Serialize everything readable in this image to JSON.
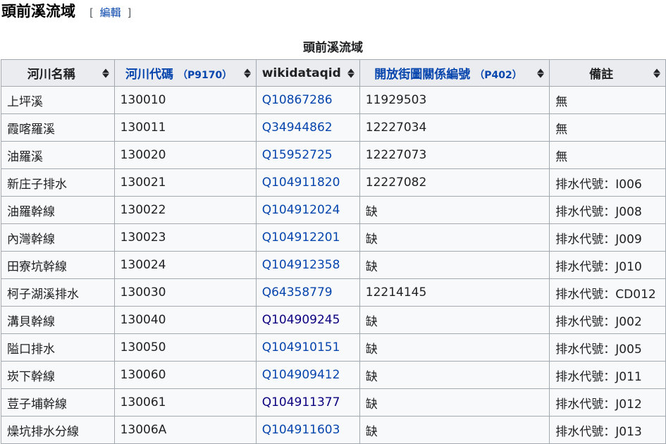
{
  "section": {
    "title": "頭前溪流域",
    "edit_open": "[",
    "edit_label": "編輯",
    "edit_close": "]"
  },
  "table": {
    "caption": "頭前溪流域",
    "headers": [
      {
        "label": "河川名稱",
        "prop": "",
        "link": false
      },
      {
        "label": "河川代碼",
        "prop": "（P9170）",
        "link": true
      },
      {
        "label": "wikidataqid",
        "prop": "",
        "link": false
      },
      {
        "label": "開放街圖關係編號",
        "prop": "（P402）",
        "link": true
      },
      {
        "label": "備註",
        "prop": "",
        "link": false
      }
    ],
    "rows": [
      {
        "name": "上坪溪",
        "code": "130010",
        "qid": "Q10867286",
        "osm": "11929503",
        "note": "無"
      },
      {
        "name": "霞喀羅溪",
        "code": "130011",
        "qid": "Q34944862",
        "osm": "12227034",
        "note": "無"
      },
      {
        "name": "油羅溪",
        "code": "130020",
        "qid": "Q15952725",
        "osm": "12227073",
        "note": "無"
      },
      {
        "name": "新庄子排水",
        "code": "130021",
        "qid": "Q104911820",
        "osm": "12227082",
        "note": "排水代號：I006"
      },
      {
        "name": "油羅幹線",
        "code": "130022",
        "qid": "Q104912024",
        "osm": "缺",
        "note": "排水代號：J008"
      },
      {
        "name": "內灣幹線",
        "code": "130023",
        "qid": "Q104912201",
        "osm": "缺",
        "note": "排水代號：J009"
      },
      {
        "name": "田寮坑幹線",
        "code": "130024",
        "qid": "Q104912358",
        "osm": "缺",
        "note": "排水代號：J010"
      },
      {
        "name": "柯子湖溪排水",
        "code": "130030",
        "qid": "Q64358779",
        "osm": "12214145",
        "note": "排水代號：CD012"
      },
      {
        "name": "溝貝幹線",
        "code": "130040",
        "qid": "Q104909245",
        "osm": "缺",
        "note": "排水代號：J002"
      },
      {
        "name": "隘口排水",
        "code": "130050",
        "qid": "Q104910151",
        "osm": "缺",
        "note": "排水代號：J005"
      },
      {
        "name": "崁下幹線",
        "code": "130060",
        "qid": "Q104909412",
        "osm": "缺",
        "note": "排水代號：J011"
      },
      {
        "name": "荳子埔幹線",
        "code": "130061",
        "qid": "Q104911377",
        "osm": "缺",
        "note": "排水代號：J012"
      },
      {
        "name": "燥坑排水分線",
        "code": "13006A",
        "qid": "Q104911603",
        "osm": "缺",
        "note": "排水代號：J013"
      }
    ]
  },
  "colors": {
    "link": "#0645ad",
    "visited_link": "#0b0080",
    "header_bg": "#eaecf0",
    "cell_bg": "#f8f9fa",
    "border": "#a2a9b1"
  }
}
